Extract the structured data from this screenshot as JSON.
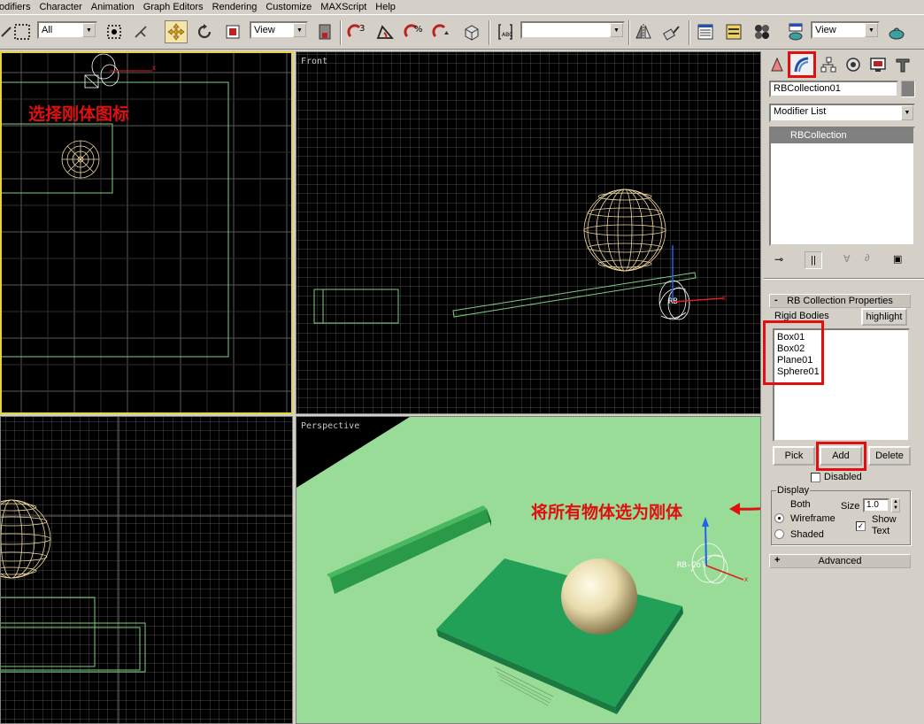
{
  "menubar": {
    "items": [
      "odifiers",
      "Character",
      "Animation",
      "Graph Editors",
      "Rendering",
      "Customize",
      "MAXScript",
      "Help"
    ]
  },
  "toolbar": {
    "selection_filter": "All",
    "ref_coord_1": "View",
    "named_selection": "",
    "ref_coord_2": "View"
  },
  "viewports": {
    "top": {
      "label": ""
    },
    "front": {
      "label": "Front"
    },
    "left": {
      "label": ""
    },
    "perspective": {
      "label": "Perspective"
    }
  },
  "annotations": {
    "select_rigid_icon": "选择刚体图标",
    "select_all_as_rigid": "将所有物体选为刚体"
  },
  "gizmo_label": "RB-Col",
  "command_panel": {
    "object_name": "RBCollection01",
    "modifier_list_label": "Modifier List",
    "stack_item": "RBCollection",
    "rollout_title": "RB Collection Properties",
    "rollout_sign": "-",
    "rigid_bodies_label": "Rigid Bodies",
    "highlight_button": "highlight",
    "bodies": [
      "Box01",
      "Box02",
      "Plane01",
      "Sphere01"
    ],
    "pick_button": "Pick",
    "add_button": "Add",
    "delete_button": "Delete",
    "disabled_label": "Disabled",
    "display_group_label": "Display",
    "both_label": "Both",
    "size_label": "Size",
    "size_value": "1.0",
    "wireframe_label": "Wireframe",
    "shaded_label": "Shaded",
    "show_text_label_1": "Show",
    "show_text_label_2": "Text",
    "advanced_title": "Advanced",
    "advanced_sign": "+"
  },
  "colors": {
    "highlight_red": "#e01010",
    "active_viewport_border": "#e6d23c",
    "grid": "#5a5a5a",
    "persp_ground": "#98dc98",
    "object_green": "#2a8c50",
    "sphere_wire": "#f0d8a0"
  }
}
